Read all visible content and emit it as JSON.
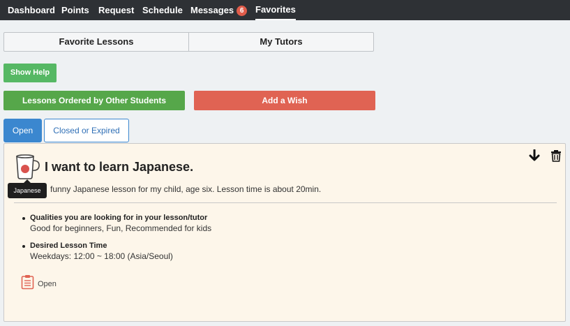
{
  "nav": {
    "items": [
      {
        "label": "Dashboard"
      },
      {
        "label": "Points"
      },
      {
        "label": "Request"
      },
      {
        "label": "Schedule"
      },
      {
        "label": "Messages",
        "badge": "6"
      },
      {
        "label": "Favorites",
        "active": true
      }
    ]
  },
  "segments": {
    "favorite_lessons": "Favorite Lessons",
    "my_tutors": "My Tutors"
  },
  "buttons": {
    "show_help": "Show Help",
    "lessons_ordered": "Lessons Ordered by Other Students",
    "add_wish": "Add a Wish"
  },
  "tabs": {
    "open": "Open",
    "closed": "Closed or Expired"
  },
  "wish": {
    "title": "I want to learn Japanese.",
    "description": "funny Japanese lesson for my child, age six. Lesson time is about 20min.",
    "tooltip": "Japanese",
    "qualities_label": "Qualities you are looking for in your lesson/tutor",
    "qualities_value": "Good for beginners, Fun, Recommended for kids",
    "time_label": "Desired Lesson Time",
    "time_value": "Weekdays: 12:00 ~ 18:00 (Asia/Seoul)",
    "status": "Open"
  },
  "icons": {
    "cup": "coffee-cup-icon",
    "download": "arrow-down-icon",
    "trash": "trash-icon",
    "clipboard": "clipboard-icon"
  },
  "colors": {
    "nav_bg": "#2e3135",
    "badge": "#e05c4a",
    "help_green": "#56b864",
    "ordered_green": "#56a74a",
    "wish_red": "#e06353",
    "tab_blue": "#3b87cf",
    "card_bg": "#fdf6ea"
  }
}
